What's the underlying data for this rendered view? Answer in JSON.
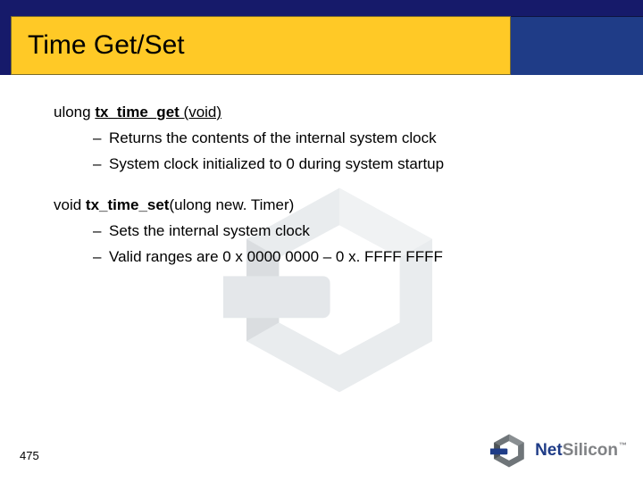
{
  "header": {
    "title": "Time Get/Set"
  },
  "content": {
    "fn1": {
      "ret": "ulong ",
      "name": "tx_time_get ",
      "args": "(void)",
      "b1": "Returns the contents of the internal system clock",
      "b2": "System clock initialized to 0 during system startup"
    },
    "fn2": {
      "ret": "void ",
      "name": "tx_time_set",
      "args": "(ulong new. Timer)",
      "b1": "Sets the internal system clock",
      "b2": "Valid ranges are 0 x 0000 0000 – 0 x. FFFF FFFF"
    }
  },
  "footer": {
    "page": "475",
    "brand_a": "Net",
    "brand_b": "Silicon",
    "tm": "™"
  }
}
